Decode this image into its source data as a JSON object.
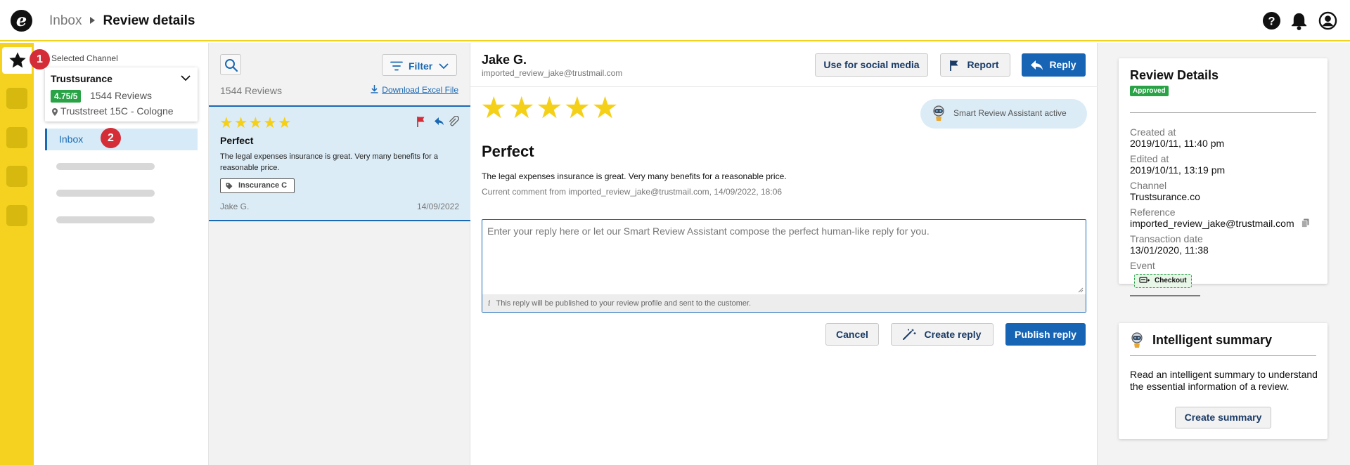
{
  "header": {
    "logo_letter": "e",
    "breadcrumb": {
      "parent": "Inbox",
      "current": "Review details"
    },
    "icons": [
      "help-icon",
      "bell-icon",
      "user-icon"
    ]
  },
  "rail": {
    "badge_1": "1",
    "badge_2": "2"
  },
  "sidebar": {
    "selected_channel_label": "Selected Channel",
    "channel": {
      "name": "Trustsurance",
      "score": "4.75/5",
      "reviews": "1544 Reviews",
      "address": "Truststreet 15C - Cologne"
    },
    "inbox_label": "Inbox"
  },
  "list": {
    "filter_label": "Filter",
    "count": "1544 Reviews",
    "download_label": "Download Excel File",
    "review": {
      "stars": "★★★★★",
      "title": "Perfect",
      "text": "The legal expenses insurance is great. Very many benefits for a reasonable price.",
      "tag": "Inscurance C",
      "author": "Jake G.",
      "date": "14/09/2022"
    }
  },
  "detail": {
    "author": "Jake G.",
    "email": "imported_review_jake@trustmail.com",
    "buttons": {
      "social": "Use for social media",
      "report": "Report",
      "reply": "Reply"
    },
    "stars": "★★★★★",
    "assistant_label": "Smart Review Assistant active",
    "title": "Perfect",
    "text": "The legal expenses insurance is great. Very many benefits for a reasonable price.",
    "meta": "Current comment from imported_review_jake@trustmail.com, 14/09/2022, 18:06",
    "reply_placeholder": "Enter your reply here or let our Smart Review Assistant compose the perfect human-like reply for you.",
    "reply_note": "This reply will be published to your review profile and sent to the customer.",
    "footer": {
      "cancel": "Cancel",
      "create": "Create reply",
      "publish": "Publish reply"
    }
  },
  "review_details": {
    "title": "Review Details",
    "status": "Approved",
    "created_label": "Created at",
    "created": "2019/10/11, 11:40 pm",
    "edited_label": "Edited at",
    "edited": "2019/10/11, 13:19 pm",
    "channel_label": "Channel",
    "channel": "Trustsurance.co",
    "reference_label": "Reference",
    "reference": "imported_review_jake@trustmail.com",
    "transaction_label": "Transaction date",
    "transaction": "13/01/2020, 11:38",
    "event_label": "Event",
    "event": "Checkout"
  },
  "summary": {
    "title": "Intelligent summary",
    "text": "Read an intelligent summary to understand the essential information of a review.",
    "button": "Create summary"
  },
  "colors": {
    "accent_yellow": "#f5d21f",
    "brand_blue": "#1664b3",
    "success_green": "#2aa347",
    "badge_red": "#d42d38"
  }
}
